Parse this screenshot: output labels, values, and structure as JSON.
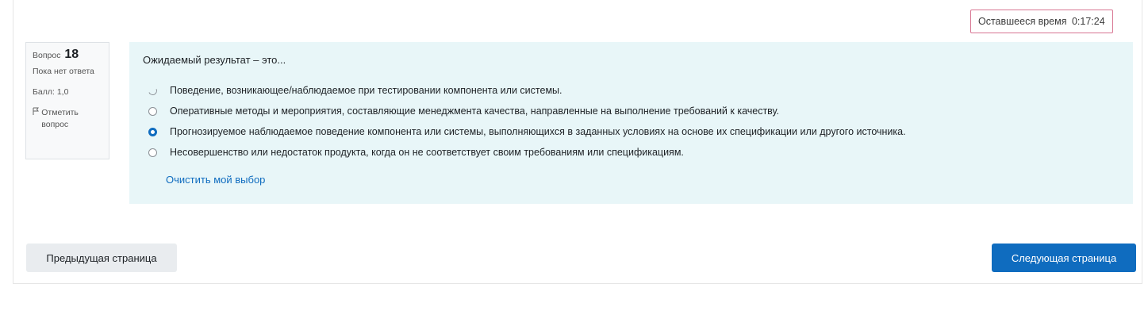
{
  "timer": {
    "label": "Оставшееся время",
    "value": "0:17:24"
  },
  "question_info": {
    "label": "Вопрос",
    "number": "18",
    "state": "Пока нет ответа",
    "grade": "Балл: 1,0",
    "flag_label": "Отметить вопрос",
    "flag_icon": "flag-icon"
  },
  "question": {
    "text": "Ожидаемый результат – это...",
    "options": [
      {
        "label": "Поведение, возникающее/наблюдаемое при тестировании компонента или системы.",
        "selected": false
      },
      {
        "label": "Оперативные методы и мероприятия, составляющие менеджмента качества, направленные на выполнение требований к качеству.",
        "selected": false
      },
      {
        "label": "Прогнозируемое наблюдаемое поведение компонента или системы, выполняющихся в заданных условиях на основе их спецификации или другого источника.",
        "selected": true
      },
      {
        "label": "Несовершенство или недостаток продукта, когда он не соответствует своим требованиям или спецификациям.",
        "selected": false
      }
    ],
    "clear_label": "Очистить мой выбор"
  },
  "navigation": {
    "prev_label": "Предыдущая страница",
    "next_label": "Следующая страница"
  },
  "colors": {
    "accent": "#0f6cbf",
    "question_bg": "#e8f6f8",
    "timer_border": "#d87592"
  }
}
